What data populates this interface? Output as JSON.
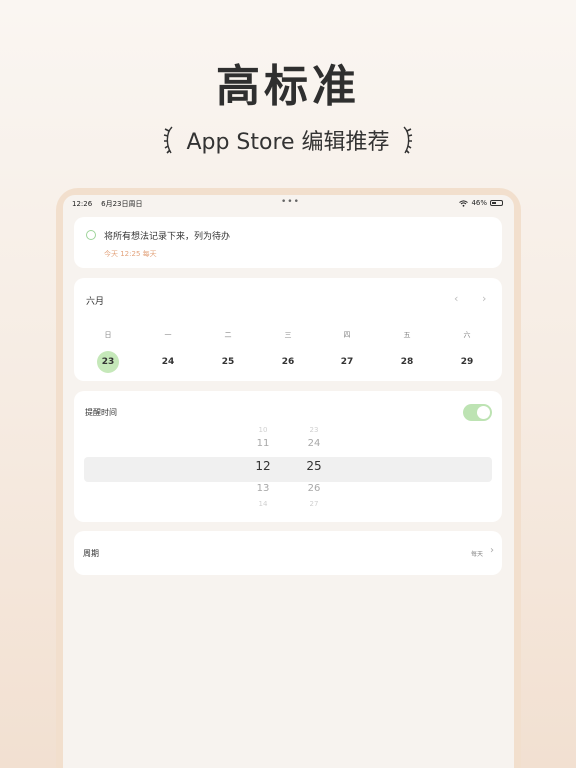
{
  "headline": "高标准",
  "subline": "App Store 编辑推荐",
  "status": {
    "time": "12:26",
    "date": "6月23日周日",
    "battery": "46%",
    "battery_level": 0.46
  },
  "todo": {
    "title": "将所有想法记录下来，列为待办",
    "meta": "今天 12:25 每天"
  },
  "calendar": {
    "month": "六月",
    "weekdays": [
      "日",
      "一",
      "二",
      "三",
      "四",
      "五",
      "六"
    ],
    "days": [
      "23",
      "24",
      "25",
      "26",
      "27",
      "28",
      "29"
    ],
    "selected_day": "23"
  },
  "reminder": {
    "label": "提醒时间",
    "enabled": true,
    "hours": [
      "10",
      "11",
      "12",
      "13",
      "14"
    ],
    "minutes": [
      "23",
      "24",
      "25",
      "26",
      "27"
    ],
    "selected_hour": "12",
    "selected_minute": "25"
  },
  "cycle": {
    "label": "周期",
    "value": "每天"
  },
  "colors": {
    "accent_green": "#c5e8b9",
    "meta_orange": "#e3a47e"
  }
}
